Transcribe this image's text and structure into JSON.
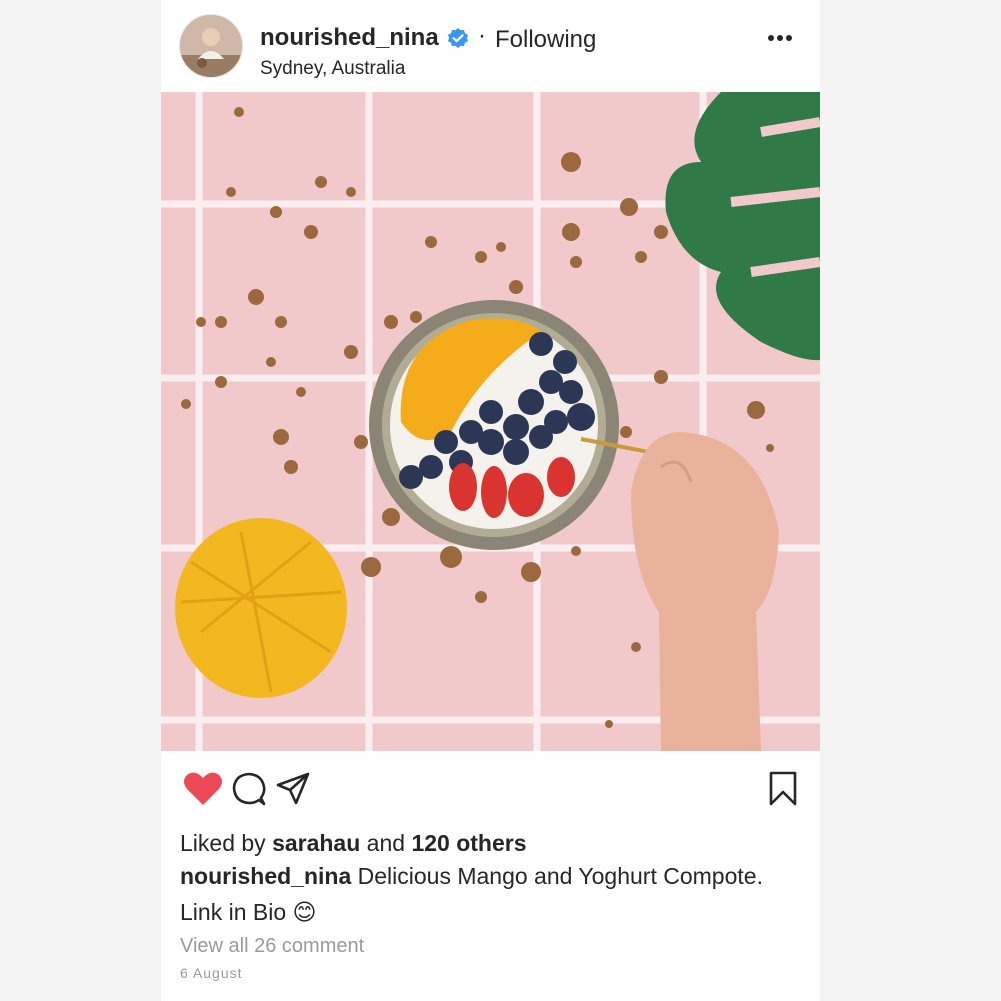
{
  "post": {
    "username": "nourished_nina",
    "separator": "·",
    "follow_status": "Following",
    "location": "Sydney, Australia",
    "liked_by_prefix": "Liked by ",
    "liked_by_user": "sarahau",
    "liked_by_and": " and ",
    "liked_by_others": "120 others",
    "caption_user": "nourished_nina",
    "caption_text": " Delicious Mango and Yoghurt Compote. Link in Bio 😊",
    "view_comments": "View all 26 comment",
    "date": "6 August"
  },
  "icons": {
    "verified": "verified-badge-icon",
    "more": "more-options-icon",
    "like": "heart-icon",
    "comment": "comment-icon",
    "share": "send-icon",
    "save": "bookmark-icon"
  },
  "colors": {
    "like": "#ee4956",
    "verified": "#3897f0",
    "text": "#262626",
    "muted": "#9a9a9a",
    "tile": "#f2c9cb"
  }
}
